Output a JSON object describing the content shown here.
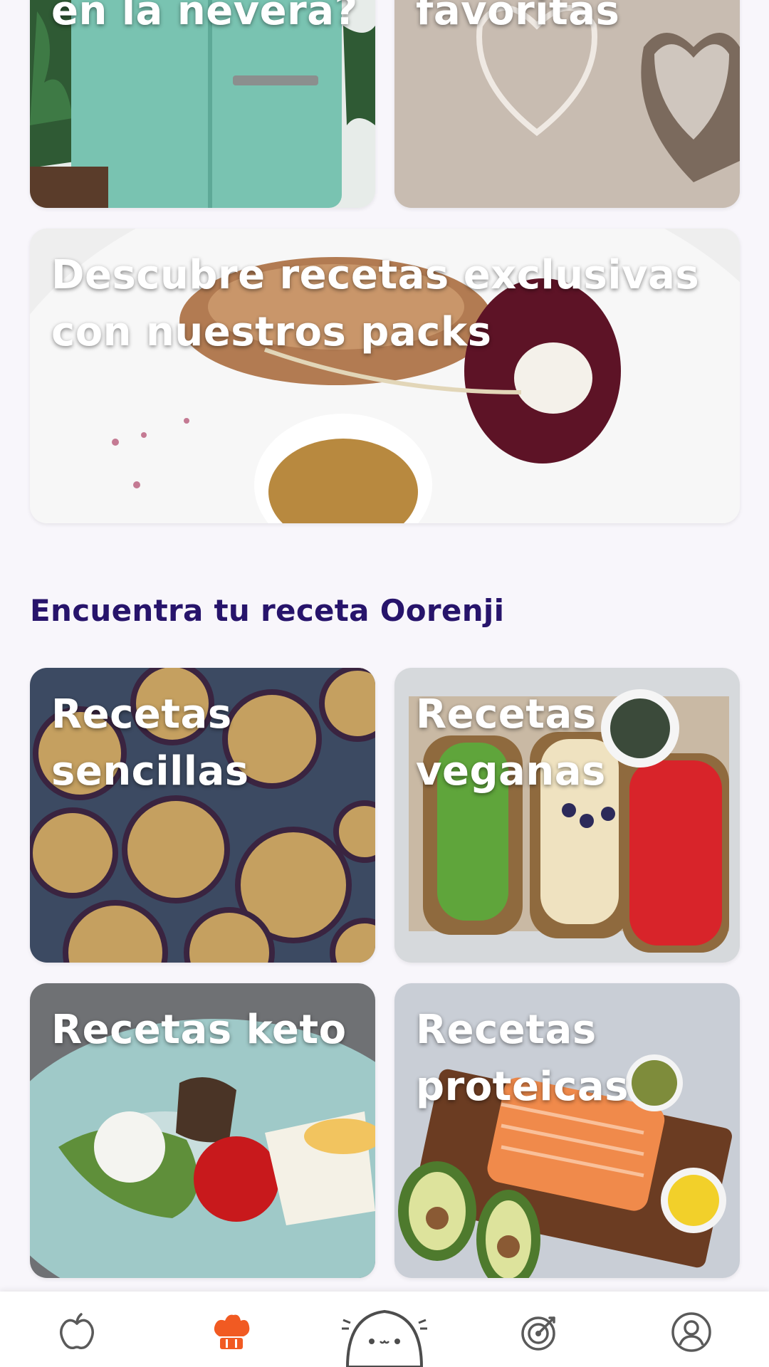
{
  "cards_top": [
    {
      "id": "fridge",
      "title": "en la nevera?"
    },
    {
      "id": "favs",
      "title": "favoritas"
    }
  ],
  "packs": {
    "title": "Descubre recetas exclusivas\ncon nuestros packs"
  },
  "section": {
    "title": "Encuentra tu receta Oorenji"
  },
  "categories": [
    {
      "id": "simple",
      "title": "Recetas\nsencillas"
    },
    {
      "id": "vegan",
      "title": "Recetas\nveganas"
    },
    {
      "id": "keto",
      "title": "Recetas keto"
    },
    {
      "id": "protein",
      "title": "Recetas\nproteicas"
    }
  ],
  "nav": {
    "active": "recipes",
    "active_color": "#f15a22",
    "inactive_color": "#5a5a5a",
    "items": [
      {
        "id": "nutrition",
        "icon": "apple-icon"
      },
      {
        "id": "recipes",
        "icon": "chef-hat-icon"
      },
      {
        "id": "home",
        "icon": "mascot-icon"
      },
      {
        "id": "goals",
        "icon": "target-icon"
      },
      {
        "id": "profile",
        "icon": "user-icon"
      }
    ]
  },
  "colors": {
    "section_title": "#27146b",
    "background": "#f8f6fb"
  }
}
